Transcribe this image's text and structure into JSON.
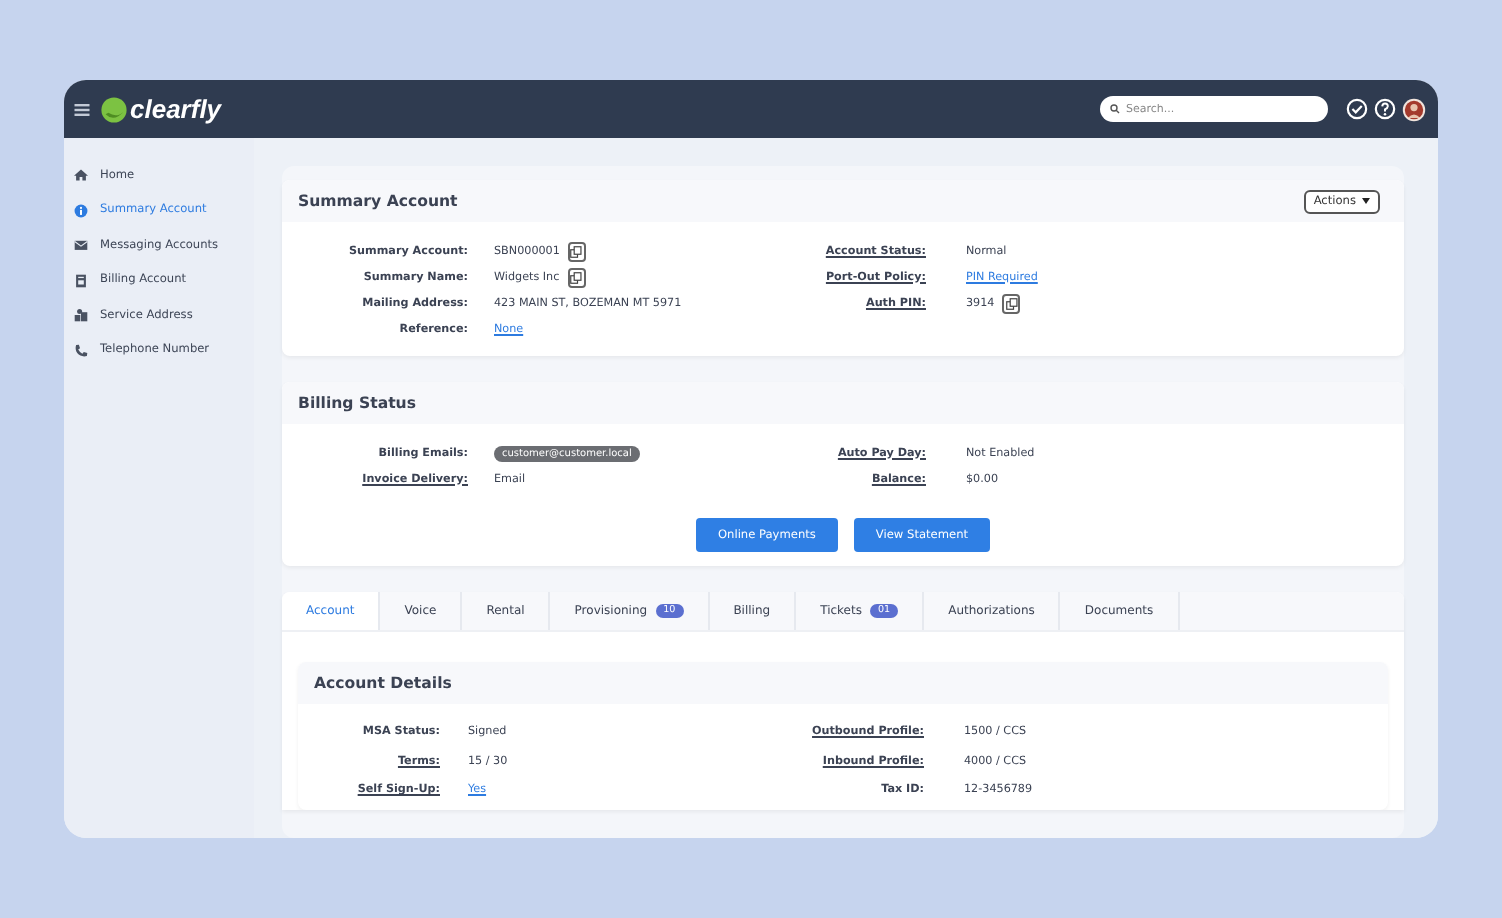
{
  "header": {
    "logo": "clearfly",
    "search": {
      "placeholder": "Search..."
    }
  },
  "sidebar": {
    "items": [
      {
        "label": "Home",
        "selected": false
      },
      {
        "label": "Summary Account",
        "selected": true
      },
      {
        "label": "Messaging Accounts",
        "selected": false
      },
      {
        "label": "Billing Account",
        "selected": false
      },
      {
        "label": "Service Address",
        "selected": false
      },
      {
        "label": "Telephone Number",
        "selected": false
      }
    ]
  },
  "summary": {
    "title": "Summary Account",
    "actions": "Actions",
    "fields": [
      {
        "label": "Summary Account:",
        "value": "SBN000001",
        "kind": "text",
        "underlined": false,
        "copy_button": true
      },
      {
        "label": "Account Status:",
        "value": "Normal",
        "kind": "text",
        "underlined": true,
        "copy_button": false
      },
      {
        "label": "Summary Name:",
        "value": "Widgets Inc",
        "kind": "text",
        "underlined": false,
        "copy_button": true
      },
      {
        "label": "Port-Out Policy:",
        "value": "PIN Required",
        "kind": "link",
        "underlined": true,
        "copy_button": false
      },
      {
        "label": "Mailing Address:",
        "value": "423 MAIN ST, BOZEMAN MT 5971",
        "kind": "text",
        "underlined": false,
        "copy_button": false
      },
      {
        "label": "Auth PIN:",
        "value": "3914",
        "kind": "text",
        "underlined": true,
        "copy_button": true
      },
      {
        "label": "Reference:",
        "value": "None",
        "kind": "link",
        "underlined": false,
        "copy_button": false
      }
    ]
  },
  "billing": {
    "title": "Billing Status",
    "fields": [
      {
        "label": "Billing Emails:",
        "value": "customer@customer.local",
        "kind": "pill",
        "underlined": false,
        "copy_button": false
      },
      {
        "label": "Auto Pay Day:",
        "value": "Not Enabled",
        "kind": "text",
        "underlined": true,
        "copy_button": false
      },
      {
        "label": "Invoice Delivery:",
        "value": "Email",
        "kind": "text",
        "underlined": true,
        "copy_button": false
      },
      {
        "label": "Balance:",
        "value": "$0.00",
        "kind": "text",
        "underlined": true,
        "copy_button": false
      }
    ],
    "buttons": [
      "Online Payments",
      "View Statement"
    ]
  },
  "tabs": [
    {
      "label": "Account",
      "selected": true
    },
    {
      "label": "Voice",
      "selected": false
    },
    {
      "label": "Rental",
      "selected": false
    },
    {
      "label": "Provisioning",
      "selected": false,
      "badge": "10"
    },
    {
      "label": "Billing",
      "selected": false
    },
    {
      "label": "Tickets",
      "selected": false,
      "badge": "01"
    },
    {
      "label": "Authorizations",
      "selected": false
    },
    {
      "label": "Documents",
      "selected": false
    }
  ],
  "account_details": {
    "title": "Account Details",
    "fields": [
      {
        "label": "MSA Status:",
        "value": "Signed",
        "kind": "text",
        "underlined": false
      },
      {
        "label": "Outbound Profile:",
        "value": "1500 / CCS",
        "kind": "text",
        "underlined": true
      },
      {
        "label": "Terms:",
        "value": "15 / 30",
        "kind": "text",
        "underlined": true
      },
      {
        "label": "Inbound Profile:",
        "value": "4000 / CCS",
        "kind": "text",
        "underlined": true
      },
      {
        "label": "Self Sign-Up:",
        "value": "Yes",
        "kind": "link",
        "underlined": true
      },
      {
        "label": "Tax ID:",
        "value": "12-3456789",
        "kind": "text",
        "underlined": false
      }
    ]
  }
}
